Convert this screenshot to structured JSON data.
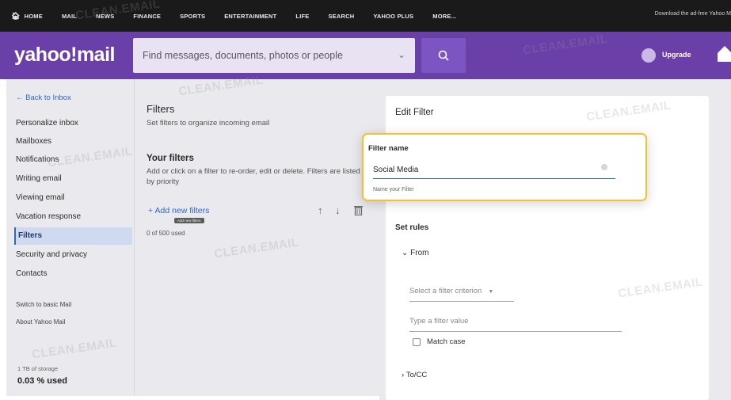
{
  "topnav": {
    "items": [
      "HOME",
      "MAIL",
      "NEWS",
      "FINANCE",
      "SPORTS",
      "ENTERTAINMENT",
      "LIFE",
      "SEARCH",
      "YAHOO PLUS",
      "MORE..."
    ],
    "adfree": "Download the ad-free Yahoo M"
  },
  "header": {
    "logo": "yahoo!mail",
    "search_placeholder": "Find messages, documents, photos or people",
    "upgrade": "Upgrade"
  },
  "sidebar": {
    "back": "← Back to Inbox",
    "items": [
      "Personalize inbox",
      "Mailboxes",
      "Notifications",
      "Writing email",
      "Viewing email",
      "Vacation response",
      "Filters",
      "Security and privacy",
      "Contacts"
    ],
    "active_index": 6,
    "links": [
      "Switch to basic Mail",
      "About Yahoo Mail"
    ],
    "storage_label": "1 TB of storage",
    "storage_used": "0.03 % used"
  },
  "filters_panel": {
    "title": "Filters",
    "subtitle": "Set filters to organize incoming email",
    "your_filters": "Your filters",
    "description": "Add or click on a filter to re-order, edit or delete. Filters are listed by priority",
    "add_label": "+ Add new filters",
    "add_tooltip": "Add new filters",
    "used": "0 of 500 used"
  },
  "edit_filter": {
    "title": "Edit Filter",
    "name_label": "Filter name",
    "name_value": "Social Media",
    "name_hint": "Name your Filter",
    "set_rules": "Set rules",
    "from_label": "From",
    "criterion_placeholder": "Select a filter criterion",
    "value_placeholder": "Type a filter value",
    "match_case": "Match case",
    "tocc_label": "To/CC"
  },
  "watermark": "CLEAN.EMAIL",
  "colors": {
    "header": "#6b3fa8",
    "link": "#2f67c9",
    "highlight": "#f1c232"
  }
}
